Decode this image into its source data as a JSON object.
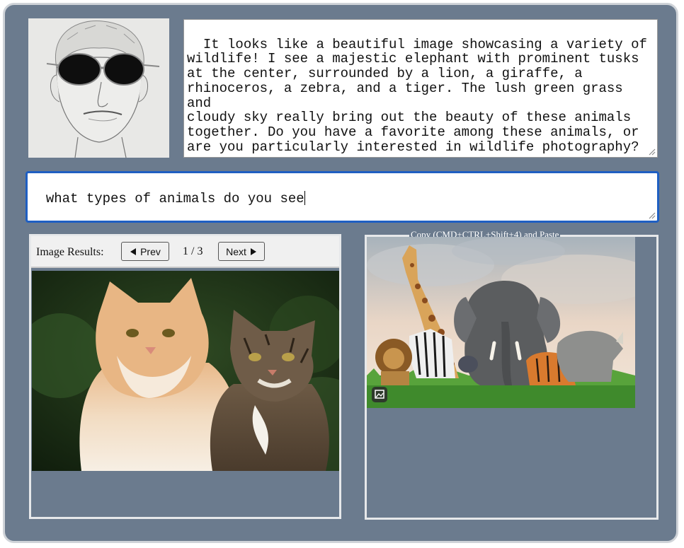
{
  "response": {
    "text": "It looks like a beautiful image showcasing a variety of\nwildlife! I see a majestic elephant with prominent tusks\nat the center, surrounded by a lion, a giraffe, a\nrhinoceros, a zebra, and a tiger. The lush green grass and\ncloudy sky really bring out the beauty of these animals\ntogether. Do you have a favorite among these animals, or\nare you particularly interested in wildlife photography?"
  },
  "prompt": {
    "value": "what types of animals do you see"
  },
  "results": {
    "label": "Image Results:",
    "prev_label": "Prev",
    "next_label": "Next",
    "page_indicator": "1 / 3"
  },
  "capture": {
    "title": "Copy (CMD+CTRL+Shift+4) and Paste"
  },
  "colors": {
    "background": "#6b7b8e",
    "panel_border": "#e6e8ea",
    "focus": "#1f5fc2"
  },
  "icons": [
    "sunglasses-face-avatar",
    "prev-triangle-icon",
    "next-triangle-icon",
    "image-badge-icon",
    "resize-grip-icon"
  ]
}
